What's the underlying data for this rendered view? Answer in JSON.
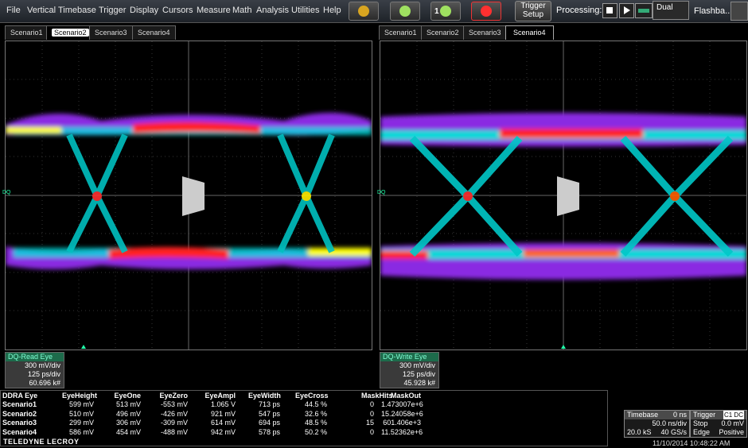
{
  "menu": [
    "File",
    "Vertical",
    "Timebase",
    "Trigger",
    "Display",
    "Cursors",
    "Measure",
    "Math",
    "Analysis",
    "Utilities",
    "Help"
  ],
  "toolbar": {
    "trigger_setup_line1": "Trigger",
    "trigger_setup_line2": "Setup",
    "processing_label": "Processing:",
    "mode_label": "Dual",
    "flashback_label": "Flashba...",
    "badge_one": "1"
  },
  "left_tabs": [
    "Scenario1",
    "Scenario2",
    "Scenario3",
    "Scenario4"
  ],
  "right_tabs": [
    "Scenario1",
    "Scenario2",
    "Scenario3",
    "Scenario4"
  ],
  "left_selected_tab": "Scenario2",
  "right_selected_tab": "Scenario4",
  "grid_label_left": "DQ",
  "grid_label_right": "DQ",
  "left_trace": {
    "name": "DQ-Read Eye",
    "vdiv": "300 mV/div",
    "tdiv": "125 ps/div",
    "count": "60.696 k#"
  },
  "right_trace": {
    "name": "DQ-Write Eye",
    "vdiv": "300 mV/div",
    "tdiv": "125 ps/div",
    "count": "45.928 k#"
  },
  "measurements": {
    "headers": [
      "DDRA Eye",
      "EyeHeight",
      "EyeOne",
      "EyeZero",
      "EyeAmpl",
      "EyeWidth",
      "EyeCross",
      "MaskHits",
      "MaskOut"
    ],
    "rows": [
      [
        "Scenario1",
        "599 mV",
        "513 mV",
        "-553 mV",
        "1.065 V",
        "713 ps",
        "44.5 %",
        "0",
        "1.473007e+6"
      ],
      [
        "Scenario2",
        "510 mV",
        "496 mV",
        "-426 mV",
        "921 mV",
        "547 ps",
        "32.6 %",
        "0",
        "15.24058e+6"
      ],
      [
        "Scenario3",
        "299 mV",
        "306 mV",
        "-309 mV",
        "614 mV",
        "694 ps",
        "48.5 %",
        "15",
        "601.406e+3"
      ],
      [
        "Scenario4",
        "586 mV",
        "454 mV",
        "-488 mV",
        "942 mV",
        "578 ps",
        "50.2 %",
        "0",
        "11.52362e+6"
      ]
    ]
  },
  "timebase": {
    "title": "Timebase",
    "offset": "0 ns",
    "per_div": "50.0 ns/div",
    "samples": "20.0 kS",
    "rate": "40 GS/s"
  },
  "trigger": {
    "title": "Trigger",
    "channel": "C1 DC",
    "mode": "Stop",
    "level": "0.0 mV",
    "type": "Edge",
    "slope": "Positive"
  },
  "brand": "TELEDYNE LECROY",
  "datetime": "11/10/2014 10:48:22 AM",
  "colors": {
    "trace_label_bg": "#1d6b4b",
    "accent": "#7fffd4"
  }
}
